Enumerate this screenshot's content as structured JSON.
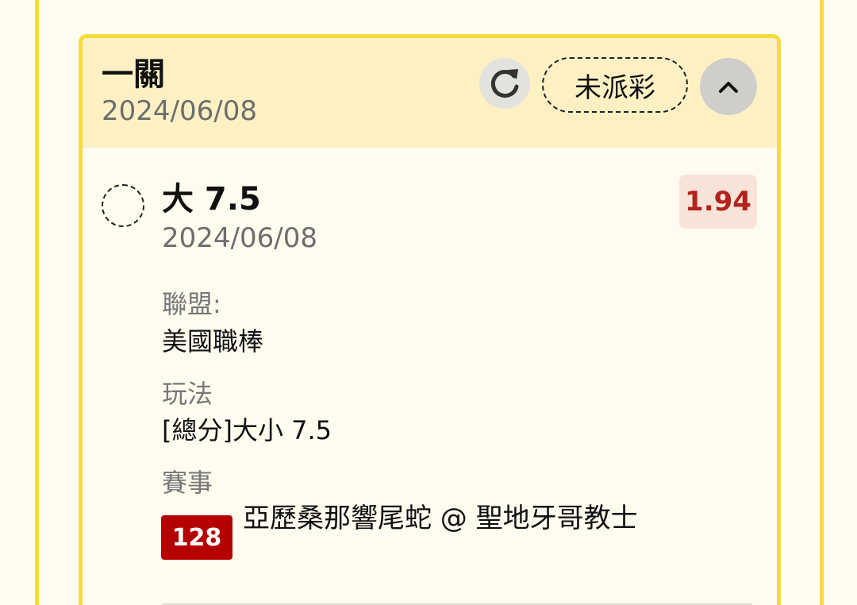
{
  "card": {
    "title": "一關",
    "date": "2024/06/08",
    "status": "未派彩",
    "icons": {
      "refresh": "refresh-icon",
      "collapse": "chevron-up-icon"
    }
  },
  "bet": {
    "selection": "大 7.5",
    "date": "2024/06/08",
    "odds": "1.94",
    "league_label": "聯盟:",
    "league_value": "美國職棒",
    "market_label": "玩法",
    "market_value": "[總分]大小 7.5",
    "event_label": "賽事",
    "match_id": "128",
    "match_name": "亞歷桑那響尾蛇 @ 聖地牙哥教士"
  },
  "colors": {
    "accent_border": "#f5dc3c",
    "header_bg": "#fdf1c4",
    "odds_text": "#b3221c",
    "match_id_bg": "#b50000"
  }
}
